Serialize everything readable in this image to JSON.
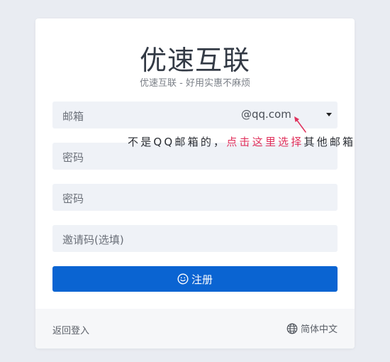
{
  "header": {
    "title": "优速互联",
    "subtitle": "优速互联 - 好用实惠不麻烦"
  },
  "form": {
    "email_placeholder": "邮箱",
    "email_suffix": "@qq.com",
    "password_placeholder": "密码",
    "confirm_password_placeholder": "密码",
    "invite_placeholder": "邀请码(选填)",
    "hint_normal_1": "不是QQ邮箱的，",
    "hint_highlight": "点击这里选择",
    "hint_normal_2": "其他邮箱",
    "submit_label": "注册"
  },
  "footer": {
    "back_label": "返回登入",
    "language_label": "简体中文"
  },
  "colors": {
    "accent": "#0a64d2",
    "highlight": "#e0315c",
    "field_bg": "#eff2f7"
  },
  "icons": {
    "submit": "smile-icon",
    "language": "globe-icon",
    "dropdown": "caret-down-icon"
  }
}
